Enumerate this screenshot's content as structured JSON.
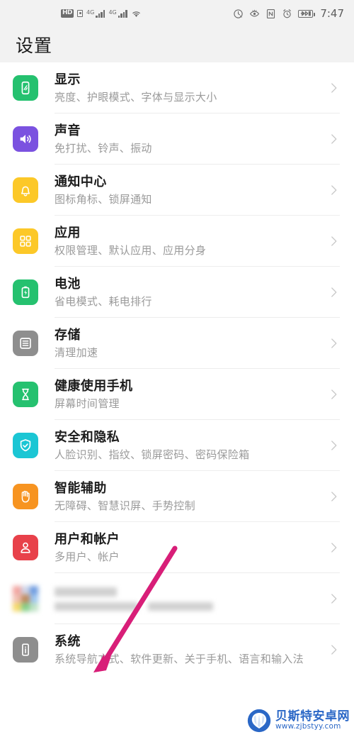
{
  "status_bar": {
    "hd_label": "HD",
    "network_label_1": "4G",
    "network_label_2": "4G",
    "time": "7:47",
    "icons": [
      "hd-badge",
      "sim-card-icon",
      "signal-4g-icon",
      "signal-4g-icon",
      "wifi-icon",
      "do-not-disturb-icon",
      "eye-comfort-icon",
      "nfc-icon",
      "alarm-icon",
      "battery-charging-icon"
    ]
  },
  "header": {
    "title": "设置"
  },
  "colors": {
    "display_icon": "#25c16f",
    "sound_icon": "#7b52e0",
    "notification_icon": "#fcc828",
    "apps_icon": "#fcc828",
    "battery_icon": "#25c16f",
    "storage_icon": "#8e8e8e",
    "digital_balance_icon": "#25c16f",
    "security_icon": "#1bc6d4",
    "smart_assistance_icon": "#f79421",
    "users_accounts_icon": "#e8414a",
    "system_icon": "#8e8e8e",
    "annotation_arrow": "#d81e78"
  },
  "settings_list": [
    {
      "id": "display",
      "title": "显示",
      "subtitle": "亮度、护眼模式、字体与显示大小",
      "icon": "display-brightness-icon"
    },
    {
      "id": "sound",
      "title": "声音",
      "subtitle": "免打扰、铃声、振动",
      "icon": "speaker-icon"
    },
    {
      "id": "notification-center",
      "title": "通知中心",
      "subtitle": "图标角标、锁屏通知",
      "icon": "bell-icon"
    },
    {
      "id": "apps",
      "title": "应用",
      "subtitle": "权限管理、默认应用、应用分身",
      "icon": "grid-apps-icon"
    },
    {
      "id": "battery",
      "title": "电池",
      "subtitle": "省电模式、耗电排行",
      "icon": "battery-bolt-icon"
    },
    {
      "id": "storage",
      "title": "存储",
      "subtitle": "清理加速",
      "icon": "storage-list-icon"
    },
    {
      "id": "digital-balance",
      "title": "健康使用手机",
      "subtitle": "屏幕时间管理",
      "icon": "hourglass-icon"
    },
    {
      "id": "security-privacy",
      "title": "安全和隐私",
      "subtitle": "人脸识别、指纹、锁屏密码、密码保险箱",
      "icon": "shield-check-icon"
    },
    {
      "id": "smart-assistance",
      "title": "智能辅助",
      "subtitle": "无障碍、智慧识屏、手势控制",
      "icon": "hand-icon"
    },
    {
      "id": "users-accounts",
      "title": "用户和帐户",
      "subtitle": "多用户、帐户",
      "icon": "user-account-icon"
    },
    {
      "id": "redacted",
      "title": "",
      "subtitle": "",
      "icon": "multicolor-grid-icon",
      "redacted": true
    },
    {
      "id": "system",
      "title": "系统",
      "subtitle": "系统导航方式、软件更新、关于手机、语言和输入法",
      "icon": "system-info-icon"
    }
  ],
  "annotation": {
    "type": "arrow",
    "description": "pink arrow pointing to 系统"
  },
  "watermark": {
    "site_name": "贝斯特安卓网",
    "url": "www.zjbstyy.com",
    "logo": "shell-logo-icon"
  }
}
